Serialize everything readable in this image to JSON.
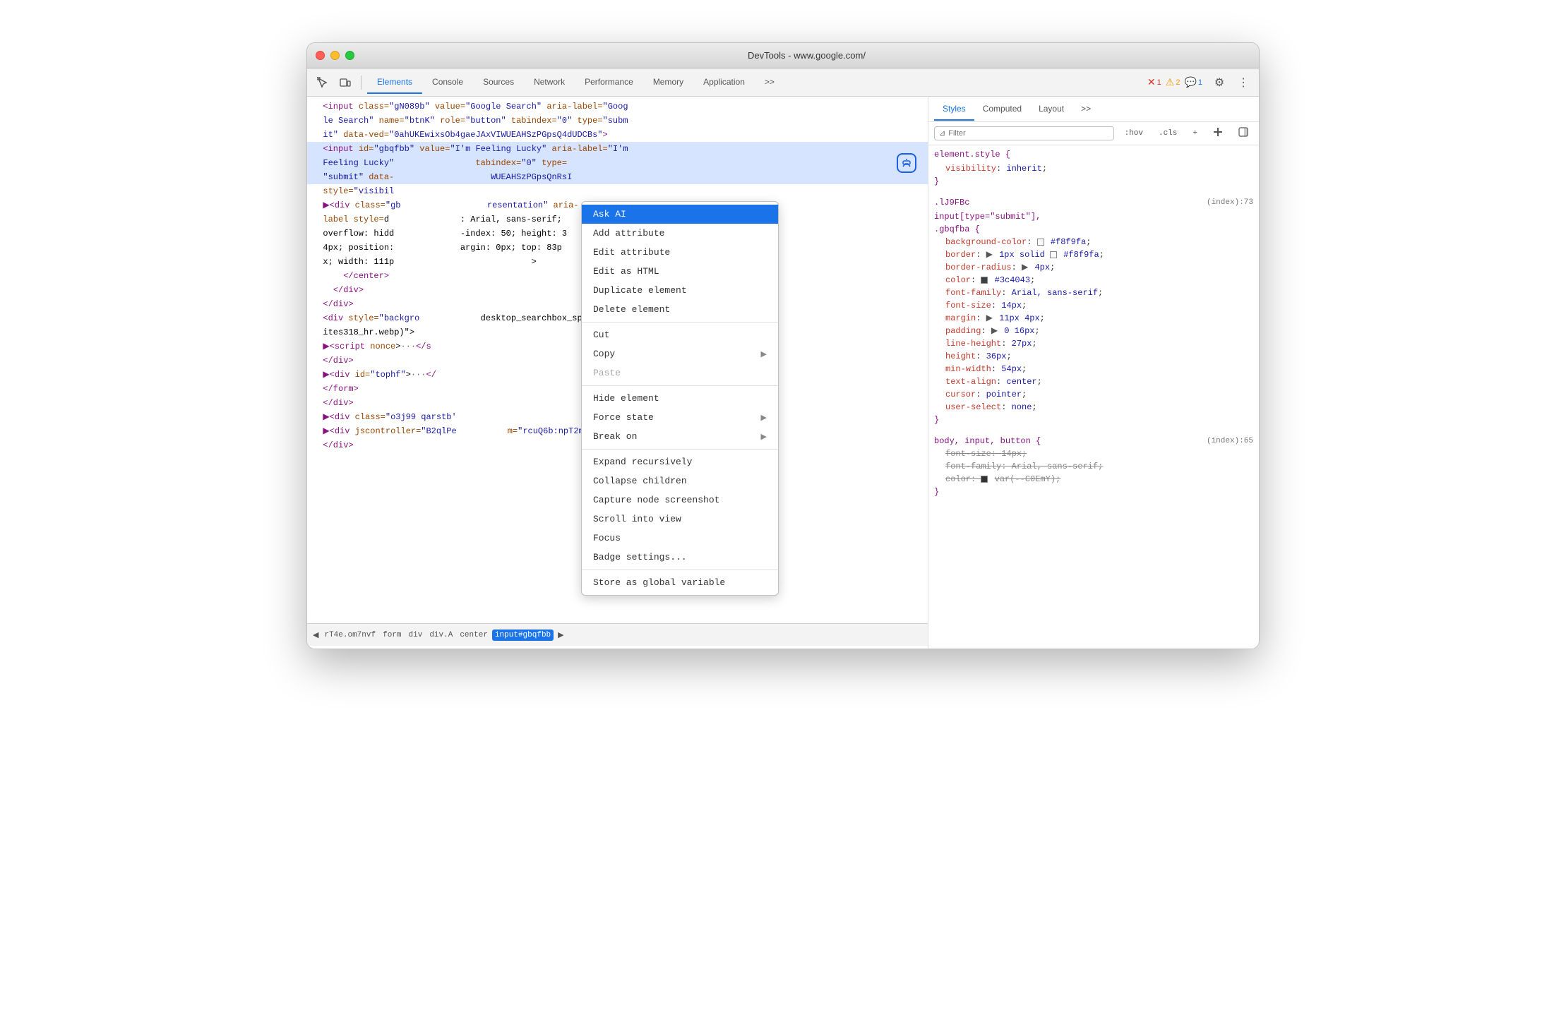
{
  "window": {
    "title": "DevTools - www.google.com/"
  },
  "toolbar": {
    "tabs": [
      {
        "label": "Elements",
        "active": true
      },
      {
        "label": "Console",
        "active": false
      },
      {
        "label": "Sources",
        "active": false
      },
      {
        "label": "Network",
        "active": false
      },
      {
        "label": "Performance",
        "active": false
      },
      {
        "label": "Memory",
        "active": false
      },
      {
        "label": "Application",
        "active": false
      }
    ],
    "more_tabs": ">>",
    "error_count": "1",
    "warning_count": "2",
    "info_count": "1"
  },
  "styles_panel": {
    "tabs": [
      "Styles",
      "Computed",
      "Layout"
    ],
    "active_tab": "Styles",
    "filter_placeholder": "Filter",
    "filter_hov": ":hov",
    "filter_cls": ".cls",
    "rules": [
      {
        "selector": "element.style {",
        "source": "",
        "properties": [
          {
            "name": "visibility",
            "value": "inherit",
            "strikethrough": false
          }
        ],
        "close": "}"
      },
      {
        "selector": ".lJ9FBc",
        "source": "(index):73",
        "selector2": "input[type=\"submit\"],",
        "selector3": ".gbqfba {",
        "properties": [
          {
            "name": "background-color",
            "value": "#f8f9fa",
            "color": "#f8f9fa",
            "strikethrough": false
          },
          {
            "name": "border",
            "value": "1px solid #f8f9fa",
            "color": "#f8f9fa",
            "has_triangle": true,
            "strikethrough": false
          },
          {
            "name": "border-radius",
            "value": "4px",
            "has_triangle": true,
            "strikethrough": false
          },
          {
            "name": "color",
            "value": "#3c4043",
            "color": "#3c4043",
            "strikethrough": false
          },
          {
            "name": "font-family",
            "value": "Arial, sans-serif",
            "strikethrough": false
          },
          {
            "name": "font-size",
            "value": "14px",
            "strikethrough": false
          },
          {
            "name": "margin",
            "value": "11px 4px",
            "has_triangle": true,
            "strikethrough": false
          },
          {
            "name": "padding",
            "value": "0 16px",
            "has_triangle": true,
            "strikethrough": false
          },
          {
            "name": "line-height",
            "value": "27px",
            "strikethrough": false
          },
          {
            "name": "height",
            "value": "36px",
            "strikethrough": false
          },
          {
            "name": "min-width",
            "value": "54px",
            "strikethrough": false
          },
          {
            "name": "text-align",
            "value": "center",
            "strikethrough": false
          },
          {
            "name": "cursor",
            "value": "pointer",
            "strikethrough": false
          },
          {
            "name": "user-select",
            "value": "none",
            "strikethrough": false
          }
        ],
        "close": "}"
      },
      {
        "selector": "body, input, button {",
        "source": "(index):65",
        "properties": [
          {
            "name": "font-size",
            "value": "14px",
            "strikethrough": true
          },
          {
            "name": "font-family",
            "value": "Arial, sans-serif",
            "strikethrough": true
          },
          {
            "name": "color",
            "value": "var(--C0EmY)",
            "color": "#333",
            "strikethrough": true
          }
        ],
        "close": "}"
      }
    ]
  },
  "context_menu": {
    "items": [
      {
        "label": "Ask AI",
        "highlighted": true,
        "has_arrow": false
      },
      {
        "label": "Add attribute",
        "highlighted": false,
        "has_arrow": false
      },
      {
        "label": "Edit attribute",
        "highlighted": false,
        "has_arrow": false
      },
      {
        "label": "Edit as HTML",
        "highlighted": false,
        "has_arrow": false
      },
      {
        "label": "Duplicate element",
        "highlighted": false,
        "has_arrow": false
      },
      {
        "label": "Delete element",
        "highlighted": false,
        "has_arrow": false
      },
      {
        "separator": true
      },
      {
        "label": "Cut",
        "highlighted": false,
        "has_arrow": false
      },
      {
        "label": "Copy",
        "highlighted": false,
        "has_arrow": true
      },
      {
        "label": "Paste",
        "highlighted": false,
        "has_arrow": false,
        "disabled": true
      },
      {
        "separator": true
      },
      {
        "label": "Hide element",
        "highlighted": false,
        "has_arrow": false
      },
      {
        "label": "Force state",
        "highlighted": false,
        "has_arrow": true
      },
      {
        "label": "Break on",
        "highlighted": false,
        "has_arrow": true
      },
      {
        "separator": true
      },
      {
        "label": "Expand recursively",
        "highlighted": false,
        "has_arrow": false
      },
      {
        "label": "Collapse children",
        "highlighted": false,
        "has_arrow": false
      },
      {
        "label": "Capture node screenshot",
        "highlighted": false,
        "has_arrow": false
      },
      {
        "label": "Scroll into view",
        "highlighted": false,
        "has_arrow": false
      },
      {
        "label": "Focus",
        "highlighted": false,
        "has_arrow": false
      },
      {
        "label": "Badge settings...",
        "highlighted": false,
        "has_arrow": false
      },
      {
        "separator": true
      },
      {
        "label": "Store as global variable",
        "highlighted": false,
        "has_arrow": false
      }
    ]
  },
  "breadcrumb": {
    "items": [
      {
        "label": "rT4e.om7nvf",
        "active": false
      },
      {
        "label": "form",
        "active": false
      },
      {
        "label": "div",
        "active": false
      },
      {
        "label": "div.A",
        "active": false
      },
      {
        "label": "center",
        "active": false
      },
      {
        "label": "input#gbqfbb",
        "active": true
      }
    ]
  },
  "elements_html": [
    {
      "text": "  <input class=\"gN089b\" value=\"Google Search\" aria-label=\"Goog",
      "selected": false
    },
    {
      "text": "  le Search\" name=\"btnK\" role=\"button\" tabindex=\"0\" type=\"subm",
      "selected": false
    },
    {
      "text": "  it\" data-ved=\"0ahUKEwixsOb4gaeJAxVIWUEAHSzPGpsQ4dUDCBs\">",
      "selected": false
    },
    {
      "text": "  <input id=\"gbqfbb\" value=\"I'm Feeling Lucky\" aria-label=\"I'm",
      "selected": true
    },
    {
      "text": "  Feeling Lucky\"               tabindex=\"0\" type=",
      "selected": true
    },
    {
      "text": "  \"submit\" data-                    WUEAHSzPGpsQnRsI",
      "selected": true
    },
    {
      "text": "  style=\"visibil",
      "selected": false
    },
    {
      "text": "  ▶<div class=\"gb                 resentation\" aria-",
      "selected": false
    },
    {
      "text": "  label style=d              : Arial, sans-serif;",
      "selected": false
    },
    {
      "text": "  overflow: hidd             -index: 50; height: 3",
      "selected": false
    },
    {
      "text": "  4px; position:             argin: 0px; top: 83p",
      "selected": false
    },
    {
      "text": "  x; width: 111p                              >",
      "selected": false
    },
    {
      "text": "      </center>",
      "selected": false
    },
    {
      "text": "    </div>",
      "selected": false
    },
    {
      "text": "  </div>",
      "selected": false
    },
    {
      "text": "  <div style=\"backgro            desktop_searchbox_spr",
      "selected": false
    },
    {
      "text": "  ites318_hr.webp)\">",
      "selected": false
    },
    {
      "text": "  ▶<script nonce>···</s",
      "selected": false
    },
    {
      "text": "  </div>",
      "selected": false
    },
    {
      "text": "  ▶<div id=\"tophf\">···</",
      "selected": false
    },
    {
      "text": "  </form>",
      "selected": false
    },
    {
      "text": "  </div>",
      "selected": false
    },
    {
      "text": "  ▶<div class=\"o3j99 qarstb'",
      "selected": false
    },
    {
      "text": "  ▶<div jscontroller=\"B2qlPe          m=\"rcuQ6b:npT2md\">···",
      "selected": false
    },
    {
      "text": "  </div>",
      "selected": false
    }
  ]
}
